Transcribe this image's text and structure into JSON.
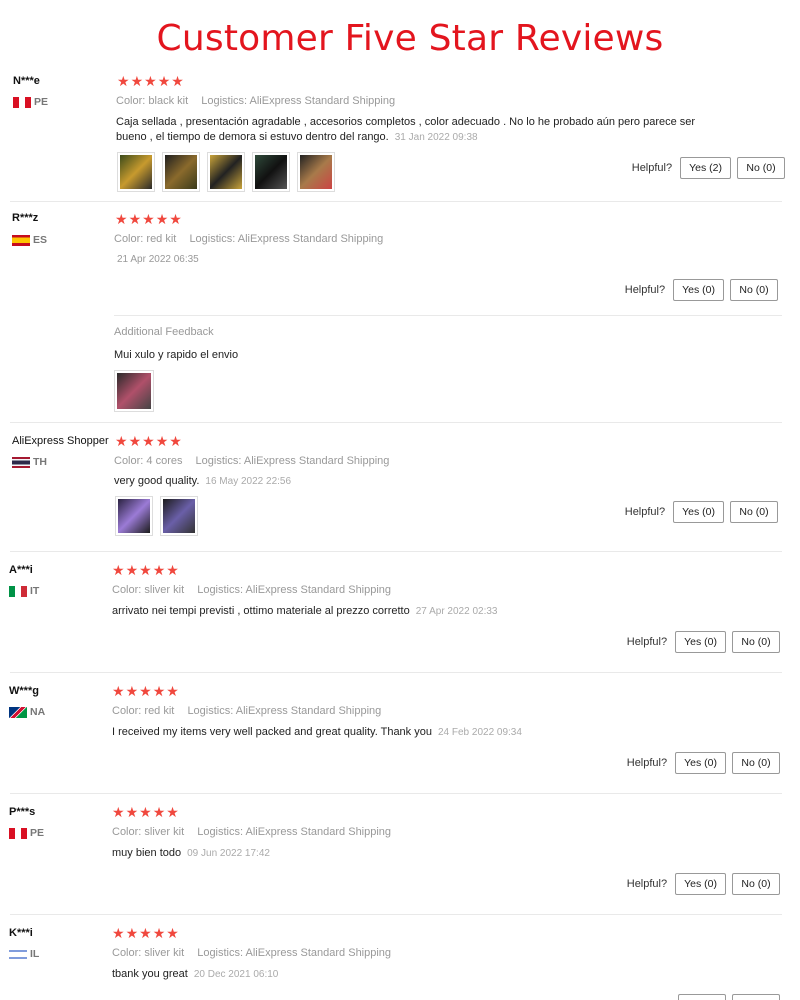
{
  "page": {
    "title": "Customer Five Star Reviews"
  },
  "labels": {
    "color": "Color:",
    "logistics": "Logistics:",
    "helpful": "Helpful?",
    "additional_feedback": "Additional Feedback"
  },
  "star_glyph": "★",
  "reviews": [
    {
      "user": "N***e",
      "country": "PE",
      "stars": 5,
      "color": "black kit",
      "logistics": "AliExpress Standard Shipping",
      "text": "Caja sellada , presentación agradable , accesorios completos , color adecuado . No lo he probado aún pero parece ser bueno , el tiempo de demora si estuvo dentro del rango.",
      "date": "31 Jan 2022 09:38",
      "yes": "Yes (2)",
      "no": "No (0)",
      "photos": 5
    },
    {
      "user": "R***z",
      "country": "ES",
      "stars": 5,
      "color": "red kit",
      "logistics": "AliExpress Standard Shipping",
      "text": "",
      "date": "21 Apr 2022 06:35",
      "yes": "Yes (0)",
      "no": "No (0)",
      "photos": 0,
      "additional": {
        "text": "Mui xulo y rapido el envio",
        "photos": 1
      }
    },
    {
      "user": "AliExpress Shopper",
      "country": "TH",
      "stars": 5,
      "color": "4 cores",
      "logistics": "AliExpress Standard Shipping",
      "text": "very good quality.",
      "date": "16 May 2022 22:56",
      "yes": "Yes (0)",
      "no": "No (0)",
      "photos": 2
    },
    {
      "user": "A***i",
      "country": "IT",
      "stars": 5,
      "color": "sliver kit",
      "logistics": "AliExpress Standard Shipping",
      "text": "arrivato nei tempi previsti , ottimo materiale al prezzo corretto",
      "date": "27 Apr 2022 02:33",
      "yes": "Yes (0)",
      "no": "No (0)",
      "photos": 0
    },
    {
      "user": "W***g",
      "country": "NA",
      "stars": 5,
      "color": "red kit",
      "logistics": "AliExpress Standard Shipping",
      "text": "I received my items very well packed and great quality. Thank you",
      "date": "24 Feb 2022 09:34",
      "yes": "Yes (0)",
      "no": "No (0)",
      "photos": 0
    },
    {
      "user": "P***s",
      "country": "PE",
      "stars": 5,
      "color": "sliver kit",
      "logistics": "AliExpress Standard Shipping",
      "text": "muy bien todo",
      "date": "09 Jun 2022 17:42",
      "yes": "Yes (0)",
      "no": "No (0)",
      "photos": 0
    },
    {
      "user": "K***i",
      "country": "IL",
      "stars": 5,
      "color": "sliver kit",
      "logistics": "AliExpress Standard Shipping",
      "text": "tbank you great",
      "date": "20 Dec 2021 06:10",
      "yes": "",
      "no": "",
      "photos": 0
    }
  ]
}
